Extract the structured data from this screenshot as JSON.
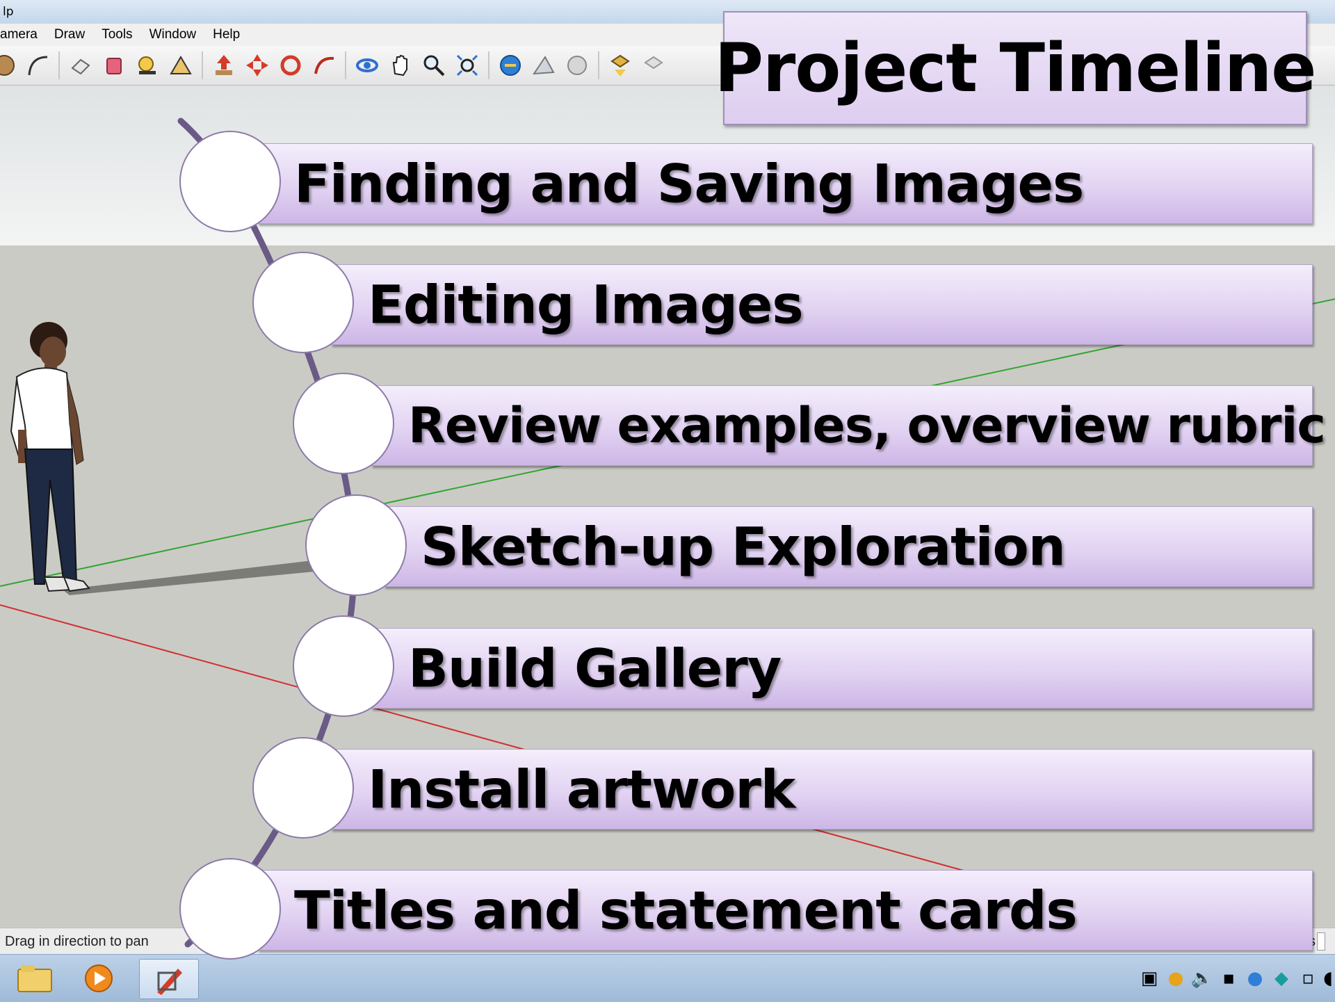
{
  "window": {
    "title_fragment": "lp"
  },
  "menubar": {
    "items": [
      "amera",
      "Draw",
      "Tools",
      "Window",
      "Help"
    ]
  },
  "toolbar": {
    "icons": [
      "circle-tool-icon",
      "arc-tool-icon",
      "eraser-icon",
      "paint-bucket-icon",
      "tape-measure-icon",
      "protractor-icon",
      "push-pull-icon",
      "move-icon",
      "rotate-icon",
      "follow-me-icon",
      "orbit-icon",
      "pan-icon",
      "zoom-icon",
      "zoom-extents-icon",
      "get-models-icon",
      "share-model-icon",
      "warehouse-icon",
      "get-component-icon",
      "share-component-icon"
    ]
  },
  "statusbar": {
    "text": "Drag in direction to pan",
    "right_label": "s"
  },
  "slide": {
    "title": "Project Timeline",
    "steps": [
      {
        "label": "Finding and Saving Images"
      },
      {
        "label": "Editing Images"
      },
      {
        "label": "Review examples, overview rubric"
      },
      {
        "label": "Sketch-up Exploration"
      },
      {
        "label": "Build Gallery"
      },
      {
        "label": "Install artwork"
      },
      {
        "label": "Titles and statement cards"
      }
    ]
  },
  "colors": {
    "slide_fill": "#e2d3f2",
    "slide_border": "#9f8fb8",
    "timeline_line": "#6a5a86",
    "green_axis": "#2fa52f",
    "red_axis": "#d03030"
  }
}
